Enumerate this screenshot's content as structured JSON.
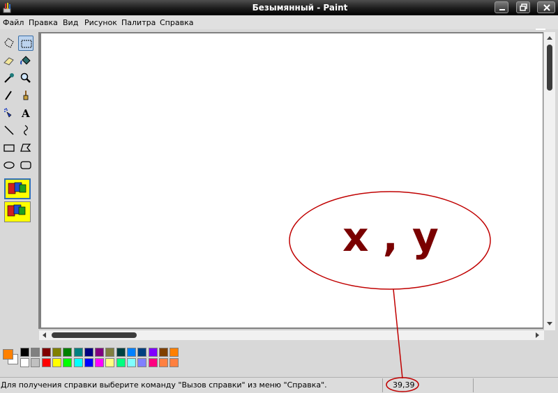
{
  "window": {
    "title": "Безымянный - Paint"
  },
  "menu": [
    "Файл",
    "Правка",
    "Вид",
    "Рисунок",
    "Палитра",
    "Справка"
  ],
  "tools": [
    {
      "name": "free-select-icon"
    },
    {
      "name": "rect-select-icon",
      "selected": true
    },
    {
      "name": "eraser-icon"
    },
    {
      "name": "fill-bucket-icon"
    },
    {
      "name": "color-picker-icon"
    },
    {
      "name": "magnifier-icon"
    },
    {
      "name": "pencil-icon"
    },
    {
      "name": "brush-icon"
    },
    {
      "name": "airbrush-icon"
    },
    {
      "name": "text-icon",
      "glyph": "A"
    },
    {
      "name": "line-icon"
    },
    {
      "name": "curve-icon"
    },
    {
      "name": "rectangle-icon"
    },
    {
      "name": "polygon-icon"
    },
    {
      "name": "ellipse-icon"
    },
    {
      "name": "rounded-rect-icon"
    }
  ],
  "palette": {
    "foreground": "#ff8000",
    "background": "#ffffff",
    "row1": [
      "#000000",
      "#808080",
      "#800000",
      "#808000",
      "#008000",
      "#008080",
      "#000080",
      "#800080",
      "#808040",
      "#004040",
      "#0080ff",
      "#004080",
      "#8000ff",
      "#804000",
      "#ff8000"
    ],
    "row2": [
      "#ffffff",
      "#c0c0c0",
      "#ff0000",
      "#ffff00",
      "#00ff00",
      "#00ffff",
      "#0000ff",
      "#ff00ff",
      "#ffff80",
      "#00ff80",
      "#80ffff",
      "#8080ff",
      "#ff0080",
      "#ff8040",
      "#ff8040"
    ]
  },
  "annotation": {
    "label": "x , y",
    "color": "#c00000"
  },
  "status": {
    "help_text": "Для получения справки выберите команду \"Вызов справки\" из меню \"Справка\".",
    "coords": "39,39"
  }
}
